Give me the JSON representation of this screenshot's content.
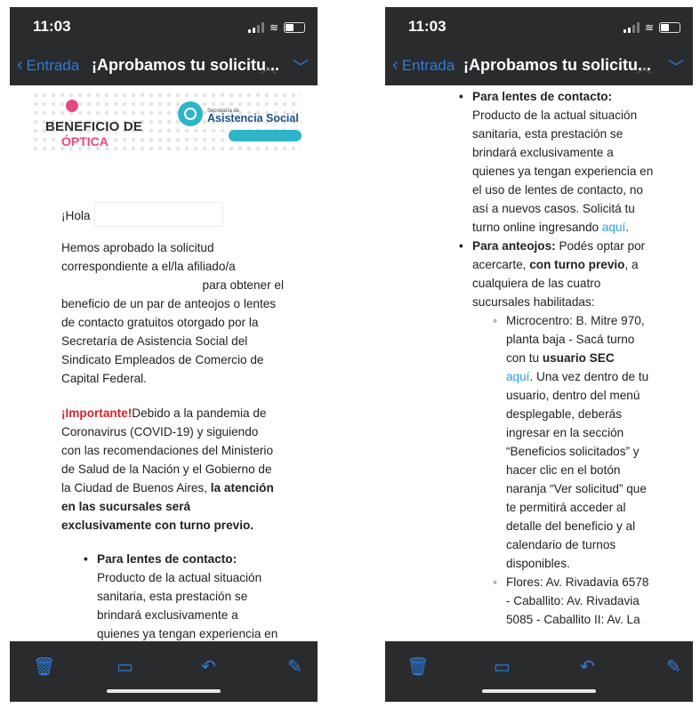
{
  "shared": {
    "time": "11:03",
    "back_label": "Entrada",
    "subject": "¡Aprobamos tu solicitu...",
    "toolbar_icons": [
      "trash-icon",
      "folder-icon",
      "reply-icon",
      "compose-icon"
    ]
  },
  "left": {
    "banner": {
      "line1": "BENEFICIO DE",
      "line2": "ÓPTICA",
      "sec_small": "Secretaría de",
      "sec_big": "Asistencia Social"
    },
    "greeting": "¡Hola",
    "intro": {
      "l1": "Hemos aprobado la solicitud",
      "l2": "correspondiente a el/la afiliado/a",
      "l3": "para obtener el",
      "l4": "beneficio de un par de anteojos o lentes",
      "l5": "de contacto gratuitos otorgado por la",
      "l6": "Secretaría de Asistencia Social del",
      "l7": "Sindicato Empleados de Comercio de",
      "l8": "Capital Federal."
    },
    "important": {
      "lead": "¡Importante!",
      "l1": "Debido a la pandemia de",
      "l2": "Coronavirus (COVID-19) y siguiendo",
      "l3": "con las recomendaciones del Ministerio",
      "l4": "de Salud de la Nación y el Gobierno de",
      "l5a": "la Ciudad de Buenos Aires, ",
      "l5b": "la atención",
      "l6": "en las sucursales será",
      "l7": "exclusivamente con turno previo."
    },
    "bullet": {
      "title": "Para lentes de contacto:",
      "l1": "Producto de la actual situación",
      "l2": "sanitaria, esta prestación se",
      "l3": "brindará exclusivamente a",
      "l4": "quienes ya tengan experiencia en"
    }
  },
  "right": {
    "b1": {
      "title": "Para lentes de contacto:",
      "l1": "Producto de la actual situación",
      "l2": "sanitaria, esta prestación se",
      "l3": "brindará exclusivamente a",
      "l4": "quienes ya tengan experiencia en",
      "l5": "el uso de lentes de contacto, no",
      "l6": "así a nuevos casos. Solicitá tu",
      "l7a": "turno online ingresando ",
      "l7link": "aquí",
      "l7b": "."
    },
    "b2": {
      "title": "Para anteojos:",
      "l1": " Podés optar por",
      "l2a": "acercarte, ",
      "l2b": "con turno previo",
      "l2c": ", a",
      "l3": "cualquiera de las cuatro",
      "l4": "sucursales habilitadas:"
    },
    "sub1": {
      "l1": "Microcentro: B. Mitre 970,",
      "l2": "planta baja - Sacá turno",
      "l3a": "con tu ",
      "l3b": "con tu usuario SEC",
      "l4link": "aquí",
      "l4": ". Una vez dentro de tu",
      "l5": "usuario, dentro del menú",
      "l6": "desplegable, deberás",
      "l7": "ingresar en la sección",
      "l8": "“Beneficios solicitados” y",
      "l9": "hacer clic en el botón",
      "l10": "naranja “Ver solicitud” que",
      "l11": "te permitirá acceder al",
      "l12": "detalle del beneficio y al",
      "l13": "calendario de turnos",
      "l14": "disponibles."
    },
    "sub2": {
      "l1": "Flores: Av. Rivadavia 6578",
      "l2": "- Caballito: Av. Rivadavia",
      "l3": "5085 - Caballito II: Av. La"
    }
  }
}
